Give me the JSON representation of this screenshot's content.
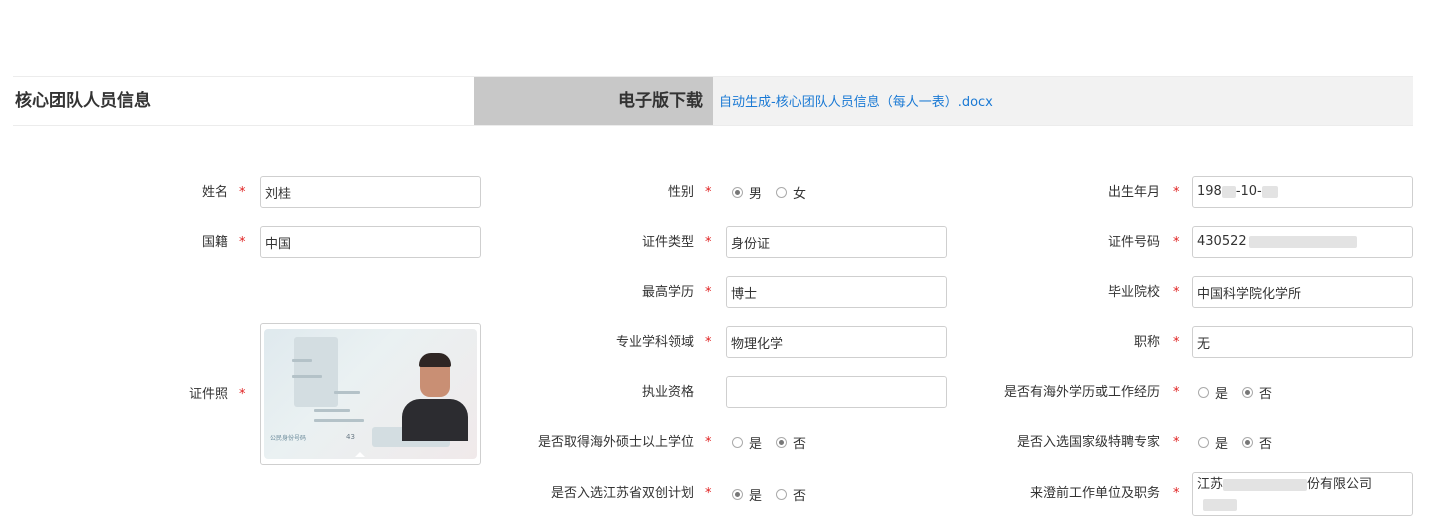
{
  "header": {
    "title": "核心团队人员信息",
    "download_label": "电子版下载",
    "download_link": "自动生成-核心团队人员信息（每人一表）.docx"
  },
  "required_mark": "*",
  "form": {
    "name": {
      "label": "姓名",
      "value": "刘桂"
    },
    "gender": {
      "label": "性别",
      "options": [
        "男",
        "女"
      ],
      "selected": "男"
    },
    "birth": {
      "label": "出生年月",
      "value_prefix": "198",
      "value_suffix": "-10-"
    },
    "nationality": {
      "label": "国籍",
      "value": "中国"
    },
    "id_type": {
      "label": "证件类型",
      "value": "身份证"
    },
    "id_number": {
      "label": "证件号码",
      "value_prefix": "430522"
    },
    "education": {
      "label": "最高学历",
      "value": "博士"
    },
    "school": {
      "label": "毕业院校",
      "value": "中国科学院化学所"
    },
    "id_photo": {
      "label": "证件照"
    },
    "field": {
      "label": "专业学科领域",
      "value": "物理化学"
    },
    "title": {
      "label": "职称",
      "value": "无"
    },
    "qualification": {
      "label": "执业资格",
      "value": ""
    },
    "overseas_exp": {
      "label": "是否有海外学历或工作经历",
      "options": [
        "是",
        "否"
      ],
      "selected": "否"
    },
    "overseas_degree": {
      "label": "是否取得海外硕士以上学位",
      "options": [
        "是",
        "否"
      ],
      "selected": "否"
    },
    "national_expert": {
      "label": "是否入选国家级特聘专家",
      "options": [
        "是",
        "否"
      ],
      "selected": "否"
    },
    "jiangsu_plan": {
      "label": "是否入选江苏省双创计划",
      "options": [
        "是",
        "否"
      ],
      "selected": "是"
    },
    "prev_employer": {
      "label": "来澄前工作单位及职务",
      "value_prefix": "江苏",
      "value_mid": "份有限公司"
    }
  },
  "id_card": {
    "tag_text": "公民身份号码",
    "number_prefix": "43"
  },
  "colors": {
    "required": "#e02020",
    "link": "#1a79d4",
    "download_bg": "#c8c8c8",
    "header_bg": "#f2f2f2"
  }
}
